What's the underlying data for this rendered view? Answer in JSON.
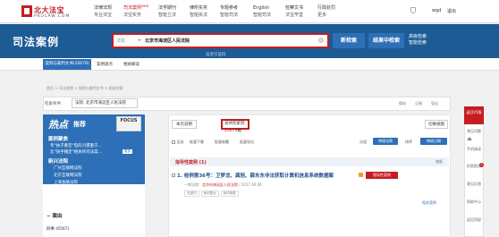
{
  "header": {
    "logo_cn": "北大法宝",
    "logo_en": "PKULAW.COM",
    "nav": [
      {
        "l1": "法律法规",
        "l2": "专业法宝"
      },
      {
        "l1": "司法案例",
        "l2": "法宝实务",
        "new": "NEW",
        "active": true
      },
      {
        "l1": "法学期刊",
        "l2": "智能立法"
      },
      {
        "l1": "律所实务",
        "l2": "智能执法"
      },
      {
        "l1": "专题参考",
        "l2": "智能司法"
      },
      {
        "l1": "English",
        "l2": "智能司法"
      },
      {
        "l1": "检察文书",
        "l2": "法宝学堂"
      },
      {
        "l1": "行政处罚",
        "l2": "更多"
      }
    ],
    "user": "wgd",
    "logout": "退出"
  },
  "banner": {
    "title": "司法案例",
    "search_scope": "法院",
    "search_value": "北京市海淀区人民法院",
    "clear_icon": "×",
    "expand_hint": "法宝引证码",
    "btn_new": "新检索",
    "btn_in": "结果中检索",
    "btn_adv_1": "高级检索",
    "btn_adv_2": "智能检索"
  },
  "tabs": {
    "tab1": "案例与裁判文书(20679)",
    "tab2": "案例观点",
    "tab3": "相关解读"
  },
  "breadcrumb": "首页 > 司法案例 > 案例与裁判文书 > 相关检索",
  "filter": {
    "label": "检索条件：",
    "value": "法院: 北京市海淀区人民法院",
    "tools": [
      "保存",
      "订阅",
      "导出"
    ]
  },
  "left": {
    "hot_title": "热点",
    "hot_sub": "推荐",
    "focus": "FOCUS",
    "sec1": "案例聚焦",
    "items1": [
      "专\"扶子重定\"电的习惯重于...",
      "北\"快手播定\"相关的司法案..."
    ],
    "badge1": "更多",
    "sec2": "新兴法院",
    "items2": [
      "广州互联网法院",
      "北京互联网法院",
      "上海金融法院"
    ],
    "case_head": "案由",
    "criminal": "刑事 (6567)"
  },
  "main": {
    "btn_sort": "本页说明",
    "total_prefix": "总共检索到",
    "total_num": "20679",
    "total_suffix": "篇",
    "btn_switch": "切换视图",
    "opts": [
      "全选",
      "批量下载",
      "批量收藏",
      "批量导出"
    ],
    "sort_label": "分组",
    "sort_sel": "审理法院",
    "order_label": "排序",
    "order_sel": "审结日期",
    "group_title": "指导性案例 (1)",
    "collapse": "收起",
    "case_title": "1. 检例第36号：卫梦龙、龚旭、薛东东非法获取计算机信息系统数据案",
    "case_tag": "指导性案例",
    "case_meta_prefix": "一审法院：",
    "case_meta_court": "北京市海淀区人民法院",
    "case_meta_date": " / 2017.06.06",
    "keywords": [
      "关键词",
      "裁判要旨",
      "案件摘要"
    ],
    "related": "相关案例"
  },
  "float": {
    "top": "返回V5版",
    "items": [
      "常见问题",
      "手机阅读",
      "检索报告",
      "意见反馈",
      "帮助中心",
      "返回顶部"
    ],
    "dot": "2"
  }
}
